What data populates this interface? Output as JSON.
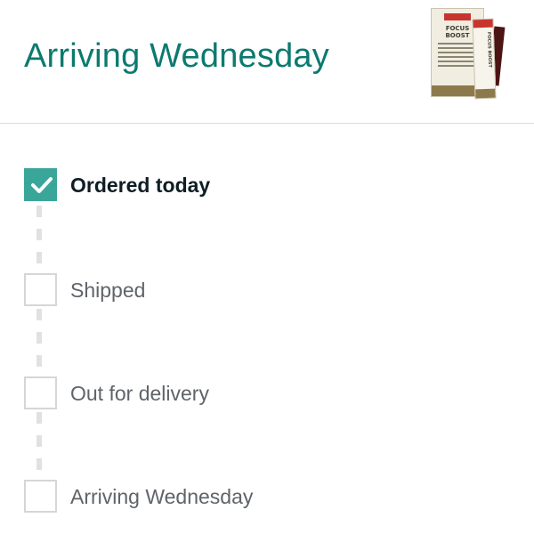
{
  "header": {
    "title": "Arriving Wednesday",
    "product": {
      "name_lines": [
        "FOCUS",
        "BOOST"
      ],
      "image_icon": "product-package-image"
    }
  },
  "tracker": {
    "steps": [
      {
        "label": "Ordered today",
        "completed": true
      },
      {
        "label": "Shipped",
        "completed": false
      },
      {
        "label": "Out for delivery",
        "completed": false
      },
      {
        "label": "Arriving Wednesday",
        "completed": false
      }
    ]
  },
  "colors": {
    "title": "#0b7a6f",
    "check_fill": "#3aa69a",
    "inactive_text": "#5f6469",
    "active_text": "#0f1d24",
    "divider": "#dcdcdc"
  }
}
